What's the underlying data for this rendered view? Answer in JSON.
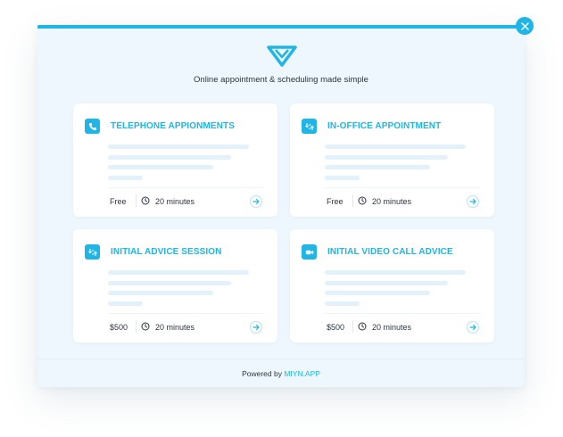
{
  "header": {
    "tagline": "Online appointment &  scheduling made simple"
  },
  "cards": [
    {
      "title": "TELEPHONE APPIONMENTS",
      "icon": "phone-icon",
      "price": "Free",
      "duration": "20 minutes"
    },
    {
      "title": "IN-OFFICE APPOINTMENT",
      "icon": "transfer-icon",
      "price": "Free",
      "duration": "20 minutes"
    },
    {
      "title": "INITIAL ADVICE SESSION",
      "icon": "transfer-icon",
      "price": "$500",
      "duration": "20 minutes"
    },
    {
      "title": "INITIAL VIDEO CALL ADVICE",
      "icon": "video-icon",
      "price": "$500",
      "duration": "20 minutes"
    }
  ],
  "footer": {
    "prefix": "Powered by ",
    "brand": "MIYN.APP"
  },
  "colors": {
    "accent": "#1fb5e6",
    "panel": "#eef7fd",
    "placeholder": "#e3f1fb",
    "text": "#2c3440"
  }
}
